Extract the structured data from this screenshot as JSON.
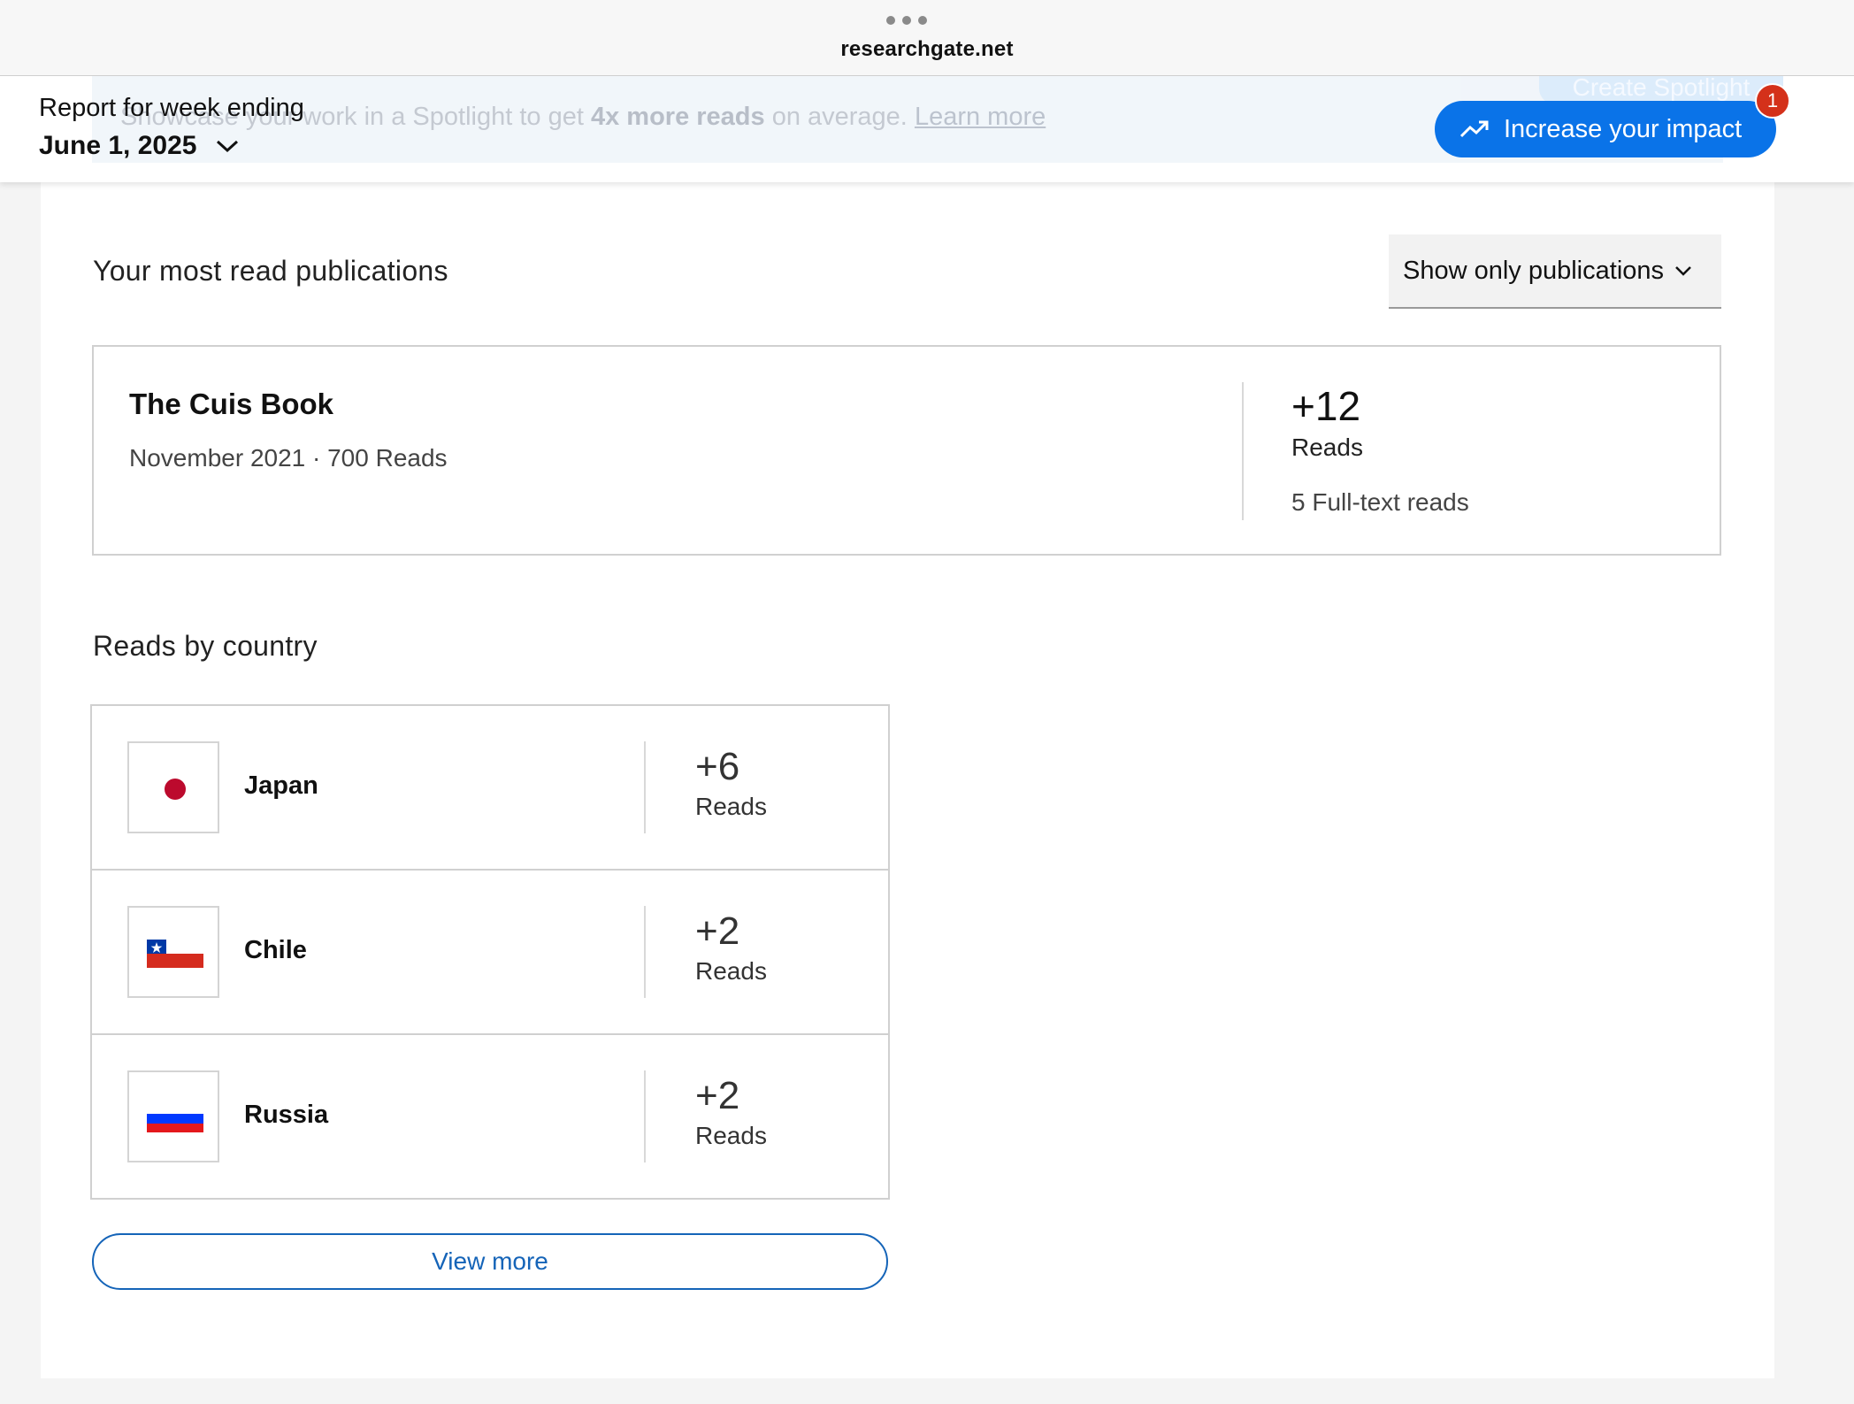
{
  "browser": {
    "domain": "researchgate.net"
  },
  "banner_ghost": {
    "text_prefix": "Showcase your work in a Spotlight to get ",
    "text_bold": "4x more reads",
    "text_suffix": " on average. ",
    "link": "Learn more",
    "button": "Create Spotlight"
  },
  "report": {
    "label": "Report for week ending",
    "date": "June 1, 2025",
    "impact_button": "Increase your impact",
    "notification_count": "1"
  },
  "publications": {
    "title": "Your most read publications",
    "filter_label": "Show only publications",
    "items": [
      {
        "title": "The Cuis Book",
        "meta": "November 2021 · 700 Reads",
        "delta": "+12",
        "delta_label": "Reads",
        "fulltext": "5 Full-text reads"
      }
    ]
  },
  "countries": {
    "title": "Reads by country",
    "rows": [
      {
        "name": "Japan",
        "delta": "+6",
        "label": "Reads",
        "flag": "japan-flag"
      },
      {
        "name": "Chile",
        "delta": "+2",
        "label": "Reads",
        "flag": "chile-flag"
      },
      {
        "name": "Russia",
        "delta": "+2",
        "label": "Reads",
        "flag": "russia-flag"
      }
    ],
    "view_more": "View more"
  },
  "colors": {
    "primary_button": "#0a73e8",
    "badge": "#d4311a",
    "link_outline": "#1564b8"
  }
}
